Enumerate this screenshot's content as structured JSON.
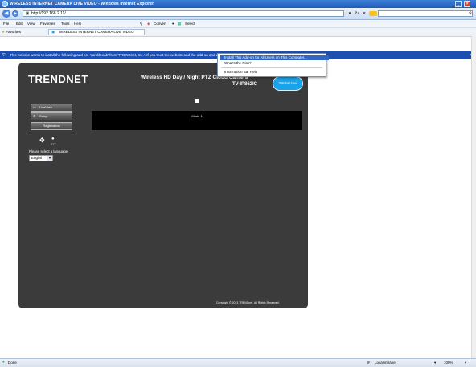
{
  "window": {
    "title": "WIRELESS INTERNET CAMERA LIVE VIDEO - Windows Internet Explorer"
  },
  "browser": {
    "address_host": "http://192.168.2.11/",
    "address_rest": "",
    "search_placeholder": "",
    "menu": [
      "File",
      "Edit",
      "View",
      "Favorites",
      "Tools",
      "Help"
    ],
    "convert_label": "Convert",
    "select_label": "Select",
    "favorites_label": "Favorites",
    "tab_title": "WIRELESS INTERNET CAMERA LIVE VIDEO"
  },
  "infobar": {
    "text": "This website wants to install the following add-on: 'camlib.cab' from 'TRENDnet, Inc.'. If you trust the website and the add-on and want to install it, click here..."
  },
  "context_menu": {
    "items": [
      "Install This Add-on for All Users on This Computer...",
      "What's the Risk?",
      "Information Bar Help"
    ]
  },
  "camera": {
    "logo": "TRENDNET",
    "product_name": "Wireless HD Day / Night PTZ Cloud Camera",
    "model": "TV-IP862IC",
    "cloud_badge": "TRENDnet Cloud",
    "buttons": {
      "liveview": "LiveView",
      "setup": "Setup",
      "registration": "Registration"
    },
    "ptz_label": "PTZ",
    "video_mode": "Mode 1",
    "language_label": "Please select a language:",
    "language_value": "English",
    "copyright": "Copyright © 2013 TRENDnet. All Rights Reserved."
  },
  "status": {
    "left": "Done",
    "zone": "Local intranet",
    "zoom": "100%"
  },
  "colors": {
    "panel_bg": "#3b3b3b",
    "infobar_bg": "#1d4fb0",
    "title_bar": "#2a66c5",
    "cloud_badge": "#1aa3e8"
  }
}
